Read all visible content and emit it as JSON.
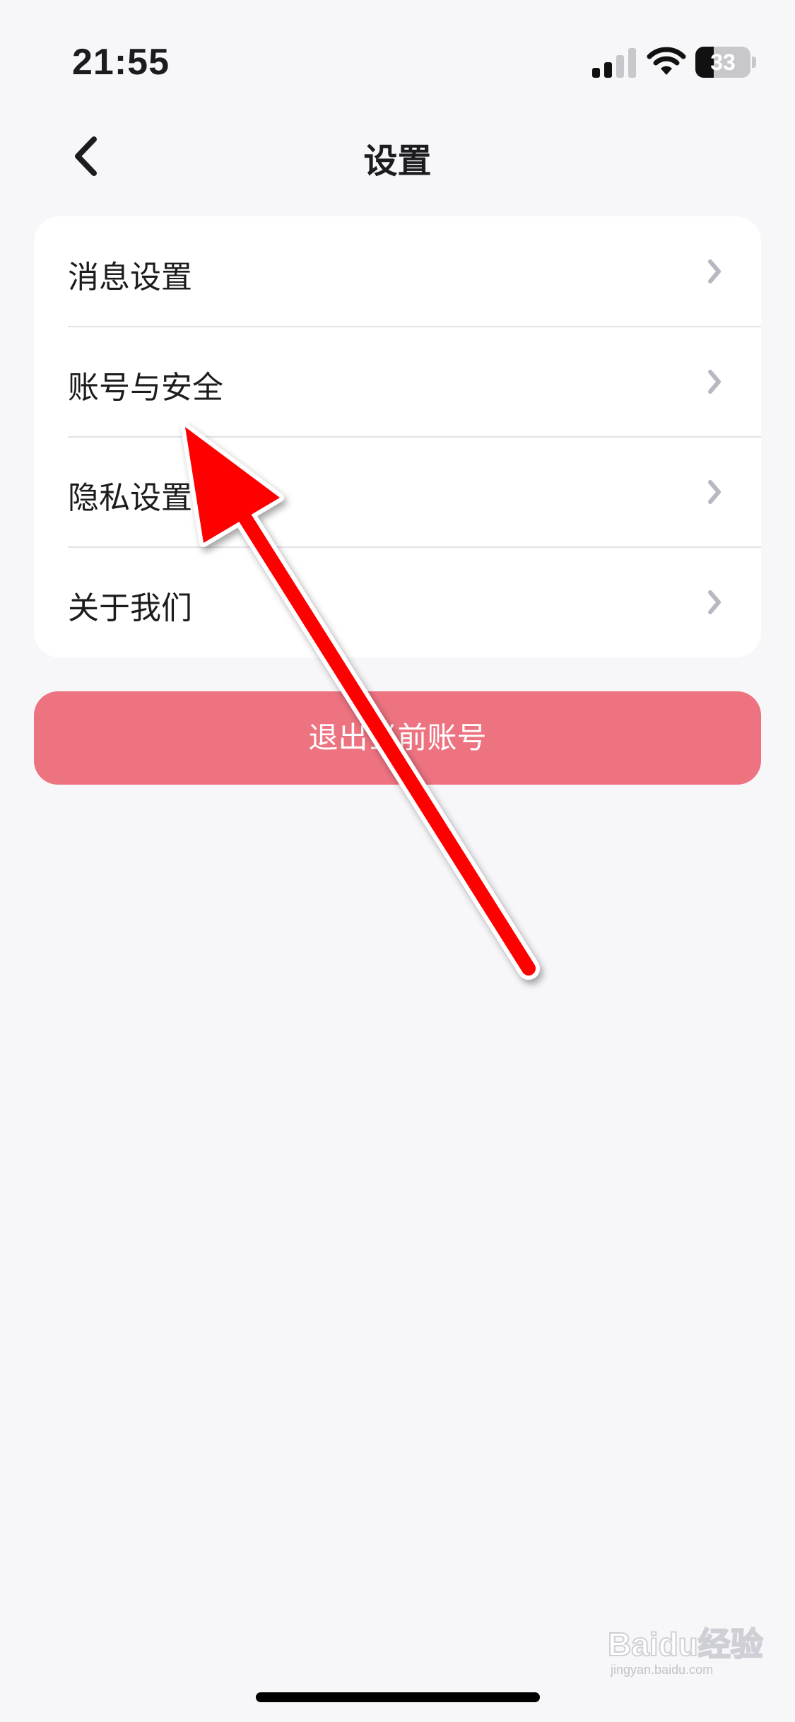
{
  "status_bar": {
    "time": "21:55",
    "battery_level": "33",
    "battery_fraction": 0.33,
    "icons": [
      "signal-icon",
      "wifi-icon",
      "battery-icon"
    ]
  },
  "nav": {
    "title": "设置",
    "back_icon": "chevron-left-icon"
  },
  "settings": {
    "items": [
      {
        "label": "消息设置",
        "icon": "chevron-right-icon"
      },
      {
        "label": "账号与安全",
        "icon": "chevron-right-icon"
      },
      {
        "label": "隐私设置",
        "icon": "chevron-right-icon"
      },
      {
        "label": "关于我们",
        "icon": "chevron-right-icon"
      }
    ]
  },
  "logout": {
    "label": "退出当前账号"
  },
  "annotation": {
    "type": "red-arrow",
    "points_to": "账号与安全"
  },
  "watermark": {
    "brand": "Baidu经验",
    "site": "jingyan.baidu.com"
  },
  "colors": {
    "background": "#f7f7fa",
    "card": "#ffffff",
    "logout_button": "#ee7381",
    "chevron": "#b8b8c2",
    "arrow": "#ff0000"
  }
}
